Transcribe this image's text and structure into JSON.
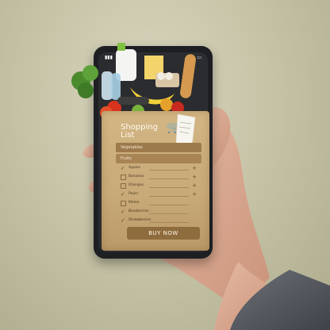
{
  "scene": {
    "background": "#c9c6ab",
    "phone_color": "#1e1f23",
    "bag_color": "#c8a978",
    "accent": "#8f6c3e"
  },
  "status_bar": {
    "time": "",
    "signal_icon": "signal-icon",
    "wifi_icon": "wifi-icon",
    "battery_icon": "battery-icon"
  },
  "shopping_list": {
    "title_line1": "Shopping",
    "title_line2": "List",
    "tabs": [
      {
        "label": "Vegetables"
      },
      {
        "label": "Fruits"
      }
    ],
    "items": [
      {
        "name": "Apples",
        "checked": true,
        "action": "+"
      },
      {
        "name": "Bananas",
        "checked": false,
        "action": "+"
      },
      {
        "name": "Oranges",
        "checked": false,
        "action": "+"
      },
      {
        "name": "Pears",
        "checked": true,
        "action": "+"
      },
      {
        "name": "Melon",
        "checked": false,
        "action": ""
      },
      {
        "name": "Blueberries",
        "checked": true,
        "action": ""
      },
      {
        "name": "Strawberries",
        "checked": true,
        "action": ""
      }
    ],
    "buy_label": "BUY NOW",
    "cart_icon": "cart-icon"
  }
}
